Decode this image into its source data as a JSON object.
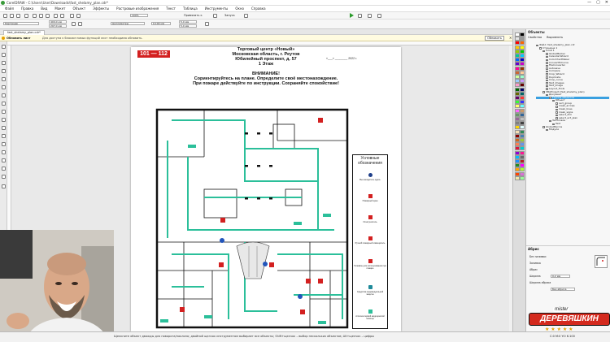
{
  "app": {
    "title": "CorelDRAW - C:\\Users\\User\\Downloads\\fast_shelamy_plan.cdr*",
    "window_controls": [
      "—",
      "▢",
      "✕"
    ]
  },
  "menu": [
    "Файл",
    "Правка",
    "Вид",
    "Макет",
    "Объект",
    "Эффекты",
    "Растровые изображения",
    "Текст",
    "Таблица",
    "Инструменты",
    "Окно",
    "Справка"
  ],
  "toolbar": {
    "zoom": "100%",
    "snap_label": "Привязать к",
    "launch_label": "Запуск"
  },
  "propbar": {
    "preset": "Картридж",
    "w_value": "400,0 мм",
    "h_value": "297,0 мм",
    "units": "миллиметры",
    "nudge": "0,100 мм",
    "dup_x": "5,0 мм",
    "dup_y": "5,0 мм"
  },
  "tab": {
    "label": "fast_shelamy_plan.cdr*"
  },
  "hint": {
    "label": "Обновить лист",
    "message": "Для доступа к блокам новых функций лист необходимо обновить.",
    "button": "Обновить",
    "close": "✕"
  },
  "plan": {
    "room_badge": "101 — 112",
    "header_lines": [
      "Торговый центр «Новый»",
      "Московская область, г. Реутов",
      "Юбилейный проспект, д. 57",
      "1 Этаж"
    ],
    "date_text": "«___» ________ 2022 г.",
    "warning_title": "ВНИМАНИЕ!",
    "warning_lines": [
      "Сориентируйтесь на плане. Определите своё местонахождение.",
      "При пожаре действуйте по инструкции. Сохраняйте спокойствие!"
    ],
    "legend_title": "Условные обозначения",
    "legend_items": [
      "Вы находитесь здесь",
      "Пожарный кран",
      "Огнетушитель",
      "Ручной пожарный извещатель",
      "Телефон для использования при пожаре",
      "Средства индивидуальной защиты",
      "Аптечка первой медицинской помощи"
    ]
  },
  "docker": {
    "title": "Объекты",
    "tabs": [
      "Свойства",
      "Выровнять"
    ],
    "tree": [
      "Файл: fast_shelamy_plan.cdr",
      "Страница 1",
      "Слой 1",
      "GlobalMarker",
      "CalendarWizard",
      "ColorChartMaker",
      "ConvertToCurve",
      "FileConverter",
      "Autosave",
      "Compare",
      "Crop_Wizard",
      "Duplicate",
      "Crop_curve",
      "Text_Images",
      "Text_image",
      "Layout_Tools",
      "VBAProject (fast_shelamy_plan)",
      "Документ",
      "Группа объектов",
      "Объект",
      "rect_group",
      "mask_arrows",
      "mask_lines",
      "mask_signs",
      "select_dim",
      "select_act_plan",
      "Заголовок",
      "Text",
      "GlobalMacros",
      "Модули"
    ],
    "selected_index": 18,
    "props_title": "Абрис",
    "props_fields": [
      "Без заливки",
      "Заливка",
      "Абрис",
      "Ширина",
      "Ширина абриса"
    ],
    "props_values": {
      "width": "0,2 мм",
      "outline": "Без абриса"
    }
  },
  "status": {
    "message": "Щелкните объект дважды для поворота/наклона; двойной щелчок инструментом выбирает все объекты; Shift+щелчок – выбор нескольких объектов; Alt+щелчок – цифры",
    "coords": "C:0 M:0 Y:0 K:100"
  },
  "branding": {
    "overlay_small": "mister",
    "overlay_main": "ДЕРЕВЯШКИН"
  },
  "colors": {
    "plan_green": "#2bbf9a",
    "badge_red": "#d32020",
    "selection_blue": "#3aa0e0",
    "logo_red": "#d42a1e"
  }
}
